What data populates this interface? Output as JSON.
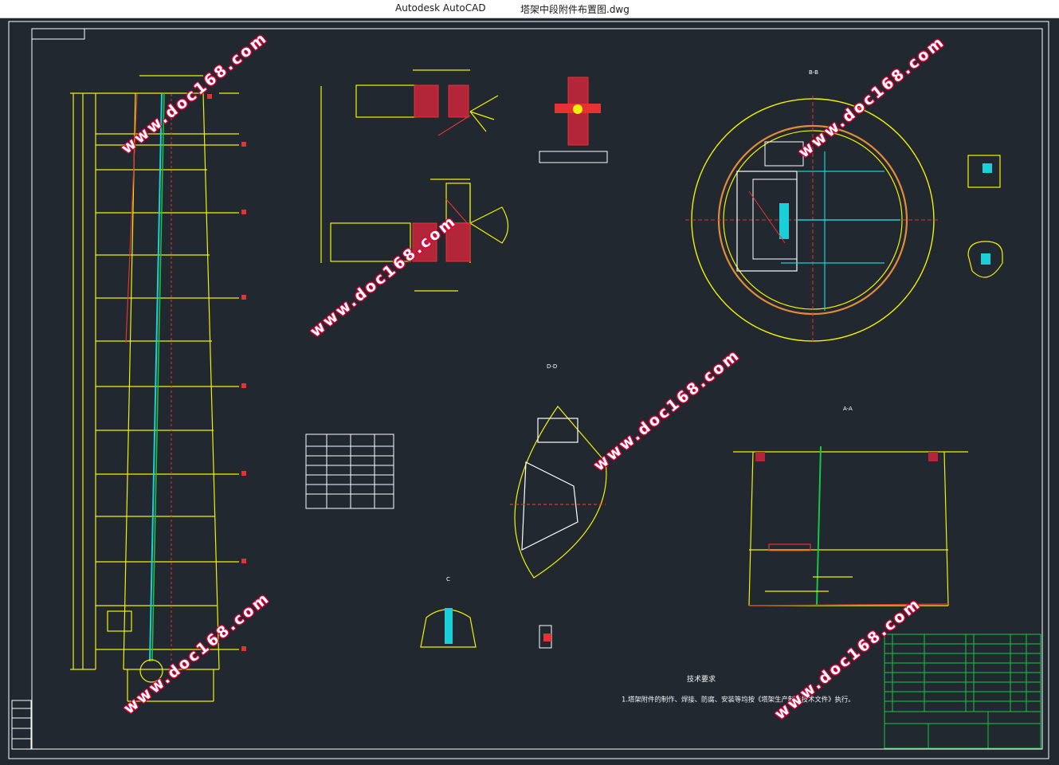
{
  "window": {
    "app_name": "Autodesk AutoCAD",
    "document_title": "塔架中段附件布置图.dwg"
  },
  "drawing": {
    "technical_requirements_title": "技术要求",
    "technical_requirements_text": "1.塔架附件的制作、焊接、防腐、安装等均按《塔架生产制造技术文件》执行。",
    "watermark_text": "www.doc168.com",
    "section_labels": [
      "B-B",
      "D-D",
      "A-A",
      "C"
    ]
  },
  "colors": {
    "canvas_bg": "#212830",
    "yellow": "#f2f200",
    "red": "#e63232",
    "cyan": "#1ad0d8",
    "white": "#ffffff",
    "green_title_block": "#16c840",
    "watermark": "#e0003a"
  }
}
